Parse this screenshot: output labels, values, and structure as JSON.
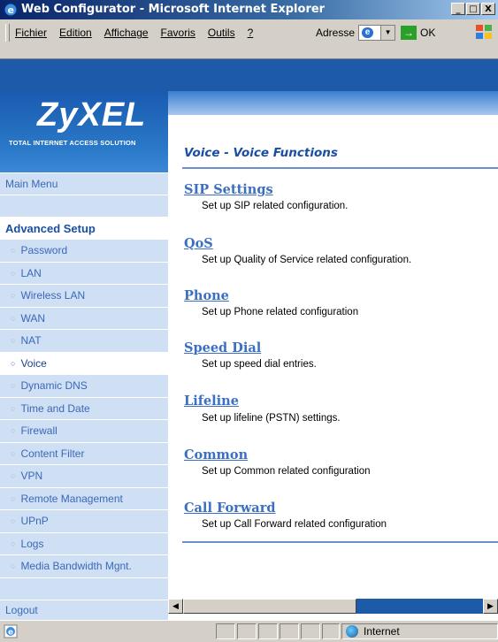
{
  "window": {
    "title": "Web Configurator - Microsoft Internet Explorer",
    "buttons": [
      "_",
      "□",
      "X"
    ]
  },
  "menubar": {
    "items": [
      "Fichier",
      "Edition",
      "Affichage",
      "Favoris",
      "Outils",
      "?"
    ],
    "address_label": "Adresse",
    "go_label": "OK"
  },
  "brand": {
    "logo": "ZyXEL",
    "tagline": "TOTAL INTERNET ACCESS SOLUTION"
  },
  "sidebar": {
    "main_menu": "Main Menu",
    "section_header": "Advanced Setup",
    "items": [
      {
        "label": "Password",
        "active": false
      },
      {
        "label": "LAN",
        "active": false
      },
      {
        "label": "Wireless LAN",
        "active": false
      },
      {
        "label": "WAN",
        "active": false
      },
      {
        "label": "NAT",
        "active": false
      },
      {
        "label": "Voice",
        "active": true
      },
      {
        "label": "Dynamic DNS",
        "active": false
      },
      {
        "label": "Time and Date",
        "active": false
      },
      {
        "label": "Firewall",
        "active": false
      },
      {
        "label": "Content Filter",
        "active": false
      },
      {
        "label": "VPN",
        "active": false
      },
      {
        "label": "Remote Management",
        "active": false
      },
      {
        "label": "UPnP",
        "active": false
      },
      {
        "label": "Logs",
        "active": false
      },
      {
        "label": "Media Bandwidth Mgnt.",
        "active": false
      }
    ],
    "logout": "Logout"
  },
  "content": {
    "title": "Voice - Voice Functions",
    "sections": [
      {
        "title": "SIP Settings",
        "desc": "Set up SIP related configuration."
      },
      {
        "title": "QoS",
        "desc": "Set up Quality of Service related configuration."
      },
      {
        "title": "Phone",
        "desc": "Set up Phone related configuration"
      },
      {
        "title": "Speed Dial",
        "desc": "Set up speed dial entries."
      },
      {
        "title": "Lifeline",
        "desc": "Set up lifeline (PSTN) settings."
      },
      {
        "title": "Common",
        "desc": "Set up Common related configuration"
      },
      {
        "title": "Call Forward",
        "desc": "Set up Call Forward related configuration"
      }
    ]
  },
  "statusbar": {
    "zone": "Internet"
  },
  "colors": {
    "accent": "#1d5aa8",
    "sidebar_bg": "#cfe0f5",
    "link": "#3a6fc4"
  }
}
